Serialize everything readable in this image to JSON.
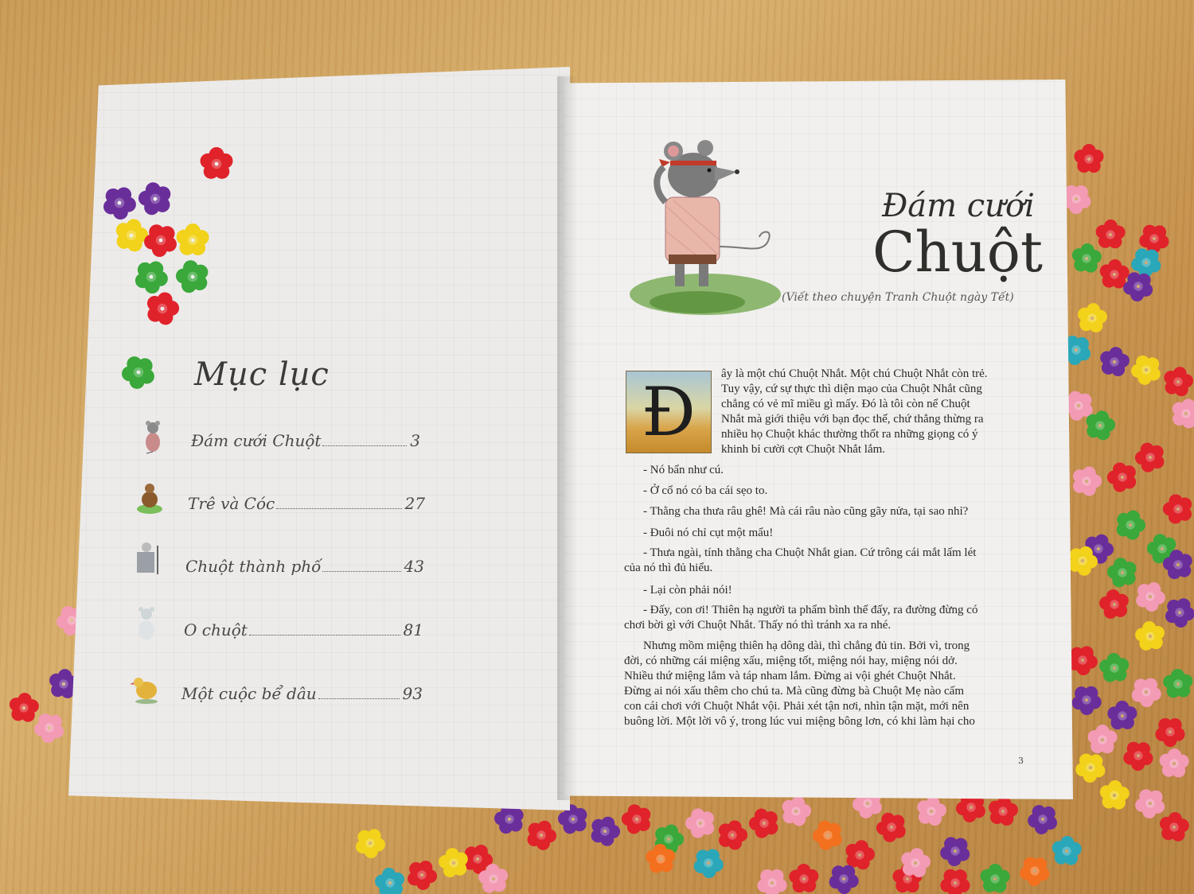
{
  "toc": {
    "title": "Mục lục",
    "items": [
      {
        "label": "Đám cưới Chuột",
        "page": "3"
      },
      {
        "label": "Trê và Cóc",
        "page": "27"
      },
      {
        "label": "Chuột thành phố",
        "page": "43"
      },
      {
        "label": "O chuột",
        "page": "81"
      },
      {
        "label": "Một cuộc bể dâu",
        "page": "93"
      }
    ]
  },
  "story": {
    "title_line1": "Đám cưới",
    "title_line2": "Chuột",
    "subtitle": "(Viết theo chuyện Tranh Chuột ngày Tết)",
    "dropcap": "Đ",
    "intro_lines": [
      "ây là một chú Chuột Nhắt. Một chú Chuột Nhắt còn trẻ.",
      "Tuy vậy, cứ sự thực thì diện mạo của Chuột Nhắt cũng",
      "chẳng có vẻ mĩ miều gì mấy. Đó là tôi còn nể Chuột",
      "Nhắt mà giới thiệu với bạn đọc thế, chứ thẳng thừng ra",
      "nhiều họ Chuột khác thường thốt ra những giọng có ý",
      "khinh bỉ cười cợt Chuột Nhắt lắm."
    ],
    "dialog": [
      "- Nó bẩn như cú.",
      "- Ở cổ nó có ba cái sẹo to.",
      "- Thằng cha thưa râu ghê! Mà cái râu nào cũng gãy nửa, tại sao nhỉ?",
      "- Đuôi nó chỉ cụt một mẩu!"
    ],
    "para1_lines": [
      "- Thưa ngài, tính thằng cha Chuột Nhắt gian. Cứ trông cái mắt lấm lét",
      "của nó thì đủ hiểu."
    ],
    "line_more": "- Lại còn phải nói!",
    "para2_lines": [
      "- Đấy, con ơi! Thiên hạ người ta phẩm bình thế đấy, ra đường đừng có",
      "chơi bời gì với Chuột Nhắt. Thấy nó thì tránh xa ra nhé."
    ],
    "para3_lines": [
      "Nhưng mồm miệng thiên hạ dông dài, thì chẳng đủ tin. Bởi vì, trong",
      "đời, có những cái miệng xấu, miệng tốt, miệng nói hay, miệng nói dở.",
      "Nhiều thứ miệng lắm và táp nham lắm. Đừng ai vội ghét Chuột Nhắt.",
      "Đừng ai nói xấu thêm cho chú ta. Mà cũng đừng bà Chuột Mẹ nào cấm",
      "con cái chơi với Chuột Nhắt vội. Phải xét tận nơi, nhìn tận mặt, mới nên",
      "buông lời. Một lời vô ý, trong lúc vui miệng bông lơn, có khi làm hại cho"
    ],
    "page_number": "3"
  },
  "colors": {
    "table": "#c99a55",
    "paper": "#f1f0ee",
    "flower_red": "#e0222a",
    "flower_purple": "#6a2e9a",
    "flower_yellow": "#f2d21a",
    "flower_green": "#3aa83a",
    "flower_pink": "#f39ab4",
    "flower_teal": "#2aa7b8",
    "flower_orange": "#f2701e"
  },
  "icons": [
    "mouse-bride-illustration-icon",
    "catfish-toad-illustration-icon",
    "city-mouse-illustration-icon",
    "mouse-aunt-illustration-icon",
    "chicken-illustration-icon",
    "mouse-girl-illustration"
  ]
}
